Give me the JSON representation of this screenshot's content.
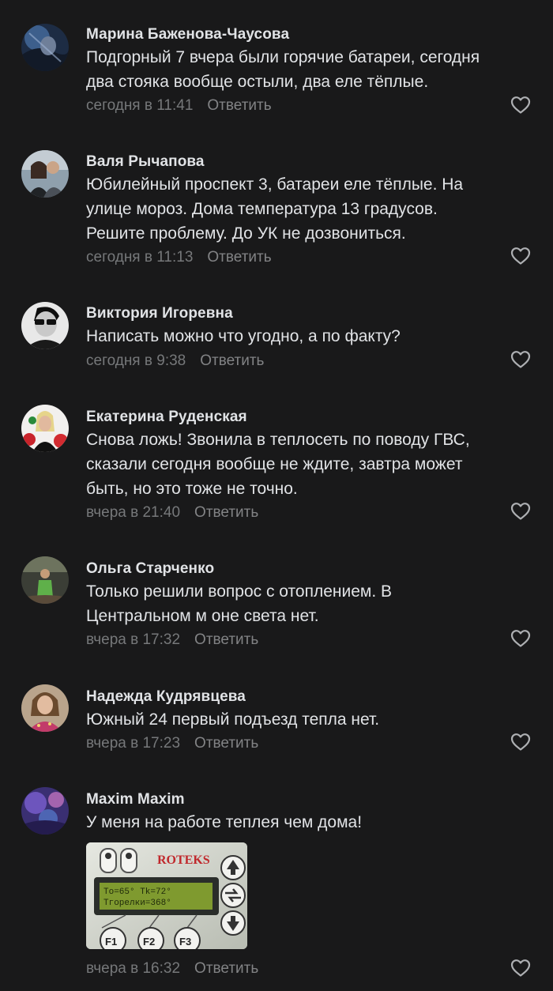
{
  "comments": [
    {
      "author": "Марина Баженова-Чаусова",
      "lines": [
        "Подгорный 7 вчера были горячие батареи, сегодня",
        "два стояка вообще остыли, два еле тёплые."
      ],
      "time": "сегодня в 11:41",
      "reply": "Ответить"
    },
    {
      "author": "Валя Рычапова",
      "lines": [
        "Юбилейный проспект 3, батареи еле тёплые. На",
        "улице мороз. Дома температура 13 градусов.",
        "Решите проблему. До УК не дозвониться."
      ],
      "time": "сегодня в 11:13",
      "reply": "Ответить"
    },
    {
      "author": "Виктория Игоревна",
      "lines": [
        "Написать можно что угодно, а по факту?"
      ],
      "time": "сегодня в 9:38",
      "reply": "Ответить"
    },
    {
      "author": "Екатерина Руденская",
      "lines": [
        "Снова ложь! Звонила в теплосеть по поводу ГВС,",
        "сказали сегодня вообще не ждите, завтра может",
        "быть, но это тоже не точно."
      ],
      "time": "вчера в 21:40",
      "reply": "Ответить"
    },
    {
      "author": "Ольга Старченко",
      "lines": [
        "Только решили вопрос с отоплением. В",
        "Центральном м оне света нет."
      ],
      "time": "вчера в 17:32",
      "reply": "Ответить"
    },
    {
      "author": "Надежда Кудрявцева",
      "lines": [
        "Южный 24 первый подъезд тепла нет."
      ],
      "time": "вчера в 17:23",
      "reply": "Ответить"
    },
    {
      "author": "Maxim Maxim",
      "lines": [
        "У меня на работе теплея чем дома!"
      ],
      "time": "вчера в 16:32",
      "reply": "Ответить",
      "photo": {
        "brand": "ROTEKS",
        "display_line1": "To=65° Tk=72°",
        "display_line2": "Tгорелки=368°",
        "buttons": [
          "F1",
          "F2",
          "F3"
        ]
      }
    }
  ],
  "icons": {
    "like": "heart-outline-icon"
  },
  "colors": {
    "background": "#19191a",
    "text_primary": "#e1e3e6",
    "text_secondary": "#76787a"
  }
}
